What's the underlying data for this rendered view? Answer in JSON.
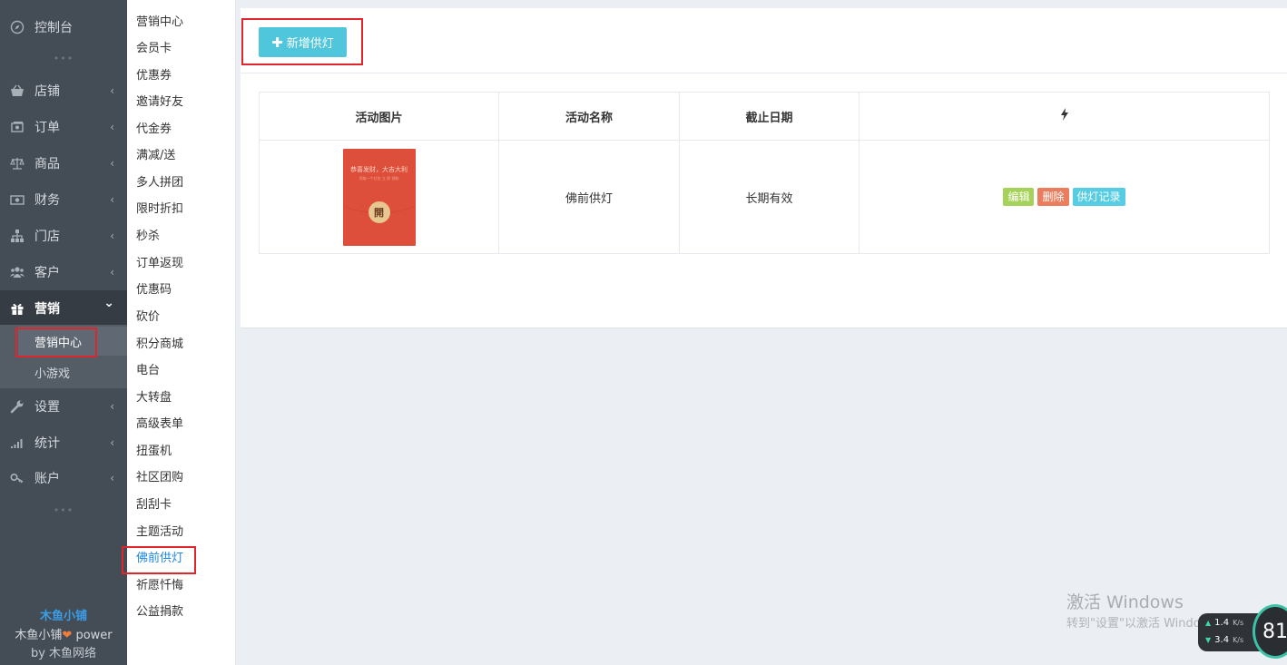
{
  "sidebar": {
    "items": [
      {
        "label": "控制台",
        "icon": "dashboard-icon"
      },
      {
        "label": "店铺",
        "icon": "store-icon"
      },
      {
        "label": "订单",
        "icon": "order-icon"
      },
      {
        "label": "商品",
        "icon": "scale-icon"
      },
      {
        "label": "财务",
        "icon": "money-icon"
      },
      {
        "label": "门店",
        "icon": "sitemap-icon"
      },
      {
        "label": "客户",
        "icon": "users-icon"
      },
      {
        "label": "营销",
        "icon": "gift-icon"
      },
      {
        "label": "设置",
        "icon": "wrench-icon"
      },
      {
        "label": "统计",
        "icon": "signal-icon"
      },
      {
        "label": "账户",
        "icon": "key-icon"
      }
    ],
    "collapse_chevron": "‹",
    "expand_chevron": "⌄",
    "dots": "•••",
    "submenu": [
      "营销中心",
      "小游戏"
    ],
    "brand": {
      "name": "木鱼小铺",
      "power_prefix": "木鱼小铺",
      "heart": "❤",
      "power_suffix": "power",
      "by": "by 木鱼网络"
    }
  },
  "marketing_menu": [
    "营销中心",
    "会员卡",
    "优惠券",
    "邀请好友",
    "代金券",
    "满减/送",
    "多人拼团",
    "限时折扣",
    "秒杀",
    "订单返现",
    "优惠码",
    "砍价",
    "积分商城",
    "电台",
    "大转盘",
    "高级表单",
    "扭蛋机",
    "社区团购",
    "刮刮卡",
    "主题活动",
    "佛前供灯",
    "祈愿忏悔",
    "公益捐款"
  ],
  "toolbar": {
    "add_button": "新增供灯",
    "add_icon": "✚"
  },
  "table": {
    "headers": [
      "活动图片",
      "活动名称",
      "截止日期"
    ],
    "action_header_icon": "lightning-icon",
    "rows": [
      {
        "thumb": {
          "line1": "恭喜发财，大吉大利",
          "line2": "领取一个红包  立 即 领取",
          "open": "開"
        },
        "name": "佛前供灯",
        "deadline": "长期有效",
        "actions": [
          "编辑",
          "删除",
          "供灯记录"
        ]
      }
    ]
  },
  "watermark": {
    "line1": "激活 Windows",
    "line2": "转到\"设置\"以激活 Windows。"
  },
  "net_widget": {
    "up": "1.4",
    "up_unit": "K/s",
    "down": "3.4",
    "down_unit": "K/s",
    "percent": "81"
  },
  "colors": {
    "sidebar_bg": "#444c56",
    "accent_cyan": "#4fc6dc",
    "edit_green": "#a5d35a",
    "delete_red": "#e97d5e",
    "record_cyan": "#56cde3",
    "active_link": "#1e88e5",
    "highlight_red": "#e0262d"
  }
}
